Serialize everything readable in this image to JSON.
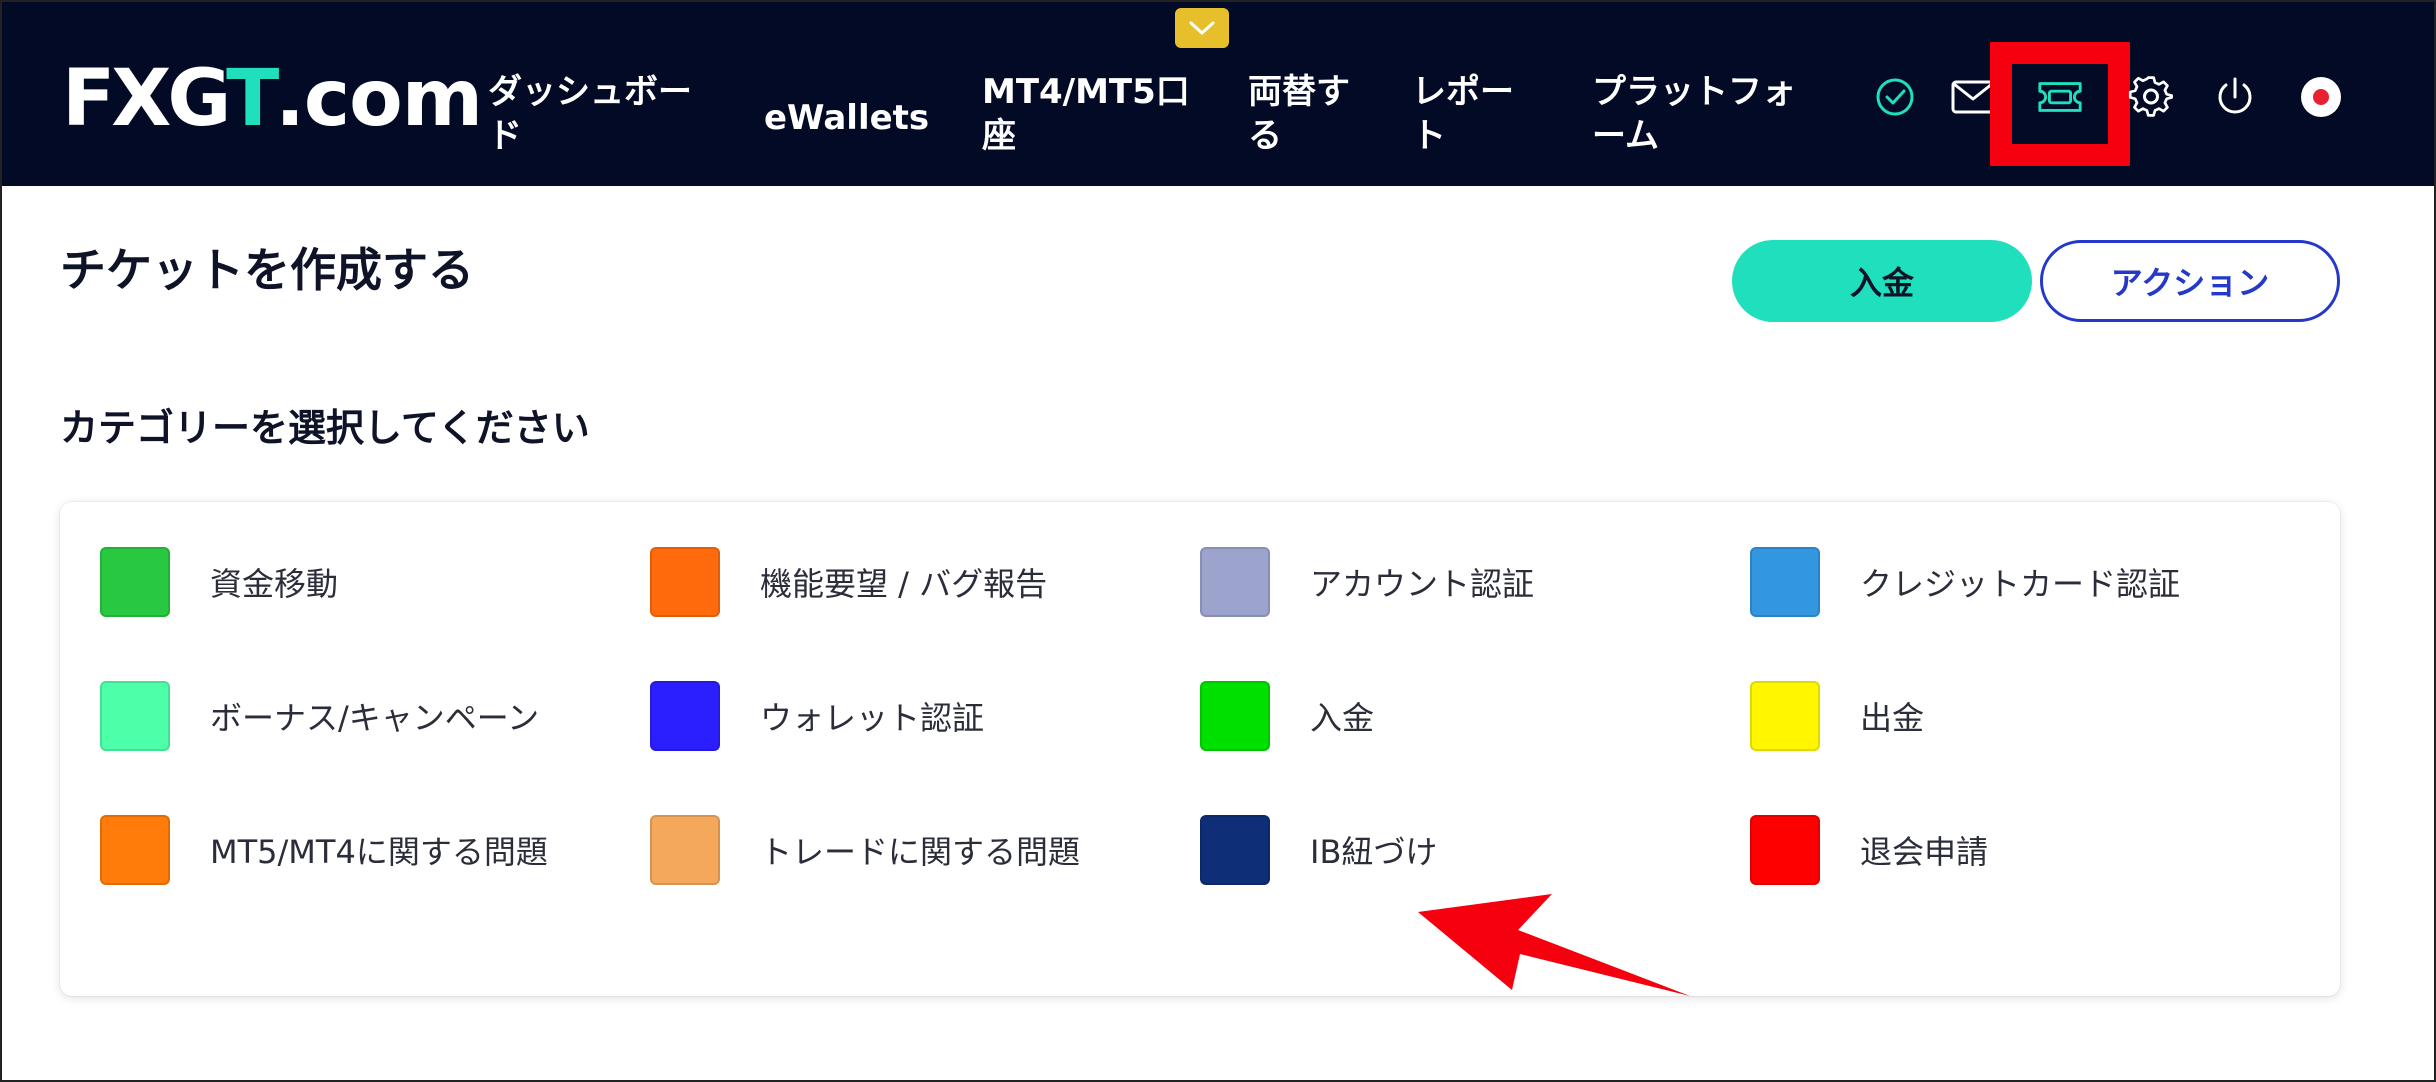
{
  "header": {
    "logo_main": "FXG",
    "logo_accent": "T",
    "logo_domain": ".com",
    "nav": [
      {
        "line1": "ダッシュボー",
        "line2": "ド"
      },
      {
        "line1": "eWallets",
        "line2": ""
      },
      {
        "line1": "MT4/MT5口",
        "line2": "座"
      },
      {
        "line1": "両替す",
        "line2": "る"
      },
      {
        "line1": "レポー",
        "line2": "ト"
      },
      {
        "line1": "プラットフォ",
        "line2": "ーム"
      }
    ],
    "icons": [
      "verified-check-icon",
      "mail-icon",
      "ticket-icon",
      "gear-icon",
      "power-icon",
      "japan-flag-icon"
    ],
    "accent_color": "#1fdfbd",
    "highlight_color": "#f5000f"
  },
  "page": {
    "title": "チケットを作成する",
    "deposit_button": "入金",
    "action_button": "アクション",
    "section_title": "カテゴリーを選択してください"
  },
  "categories": [
    {
      "label": "資金移動",
      "color": "#28c840"
    },
    {
      "label": "機能要望 / バグ報告",
      "color": "#ff6a0d"
    },
    {
      "label": "アカウント認証",
      "color": "#9ca3cc"
    },
    {
      "label": "クレジットカード認証",
      "color": "#3396e0"
    },
    {
      "label": "ボーナス/キャンペーン",
      "color": "#4dffa8"
    },
    {
      "label": "ウォレット認証",
      "color": "#2b1fff"
    },
    {
      "label": "入金",
      "color": "#00e000"
    },
    {
      "label": "出金",
      "color": "#fff600"
    },
    {
      "label": "MT5/MT4に関する問題",
      "color": "#ff7b0a"
    },
    {
      "label": "トレードに関する問題",
      "color": "#f4a85c"
    },
    {
      "label": "IB紐づけ",
      "color": "#0e2e78"
    },
    {
      "label": "退会申請",
      "color": "#ff0000"
    }
  ]
}
